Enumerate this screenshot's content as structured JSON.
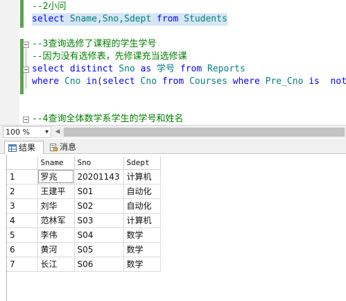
{
  "editor": {
    "lines": [
      {
        "segments": [
          {
            "t": "--2小问",
            "c": "cmt"
          }
        ]
      },
      {
        "segments": [
          {
            "t": "select",
            "c": "kw"
          },
          {
            "t": " Sname,Sno,Sdept ",
            "c": "obj"
          },
          {
            "t": "from",
            "c": "kw"
          },
          {
            "t": " Students",
            "c": "obj"
          }
        ]
      },
      {
        "segments": []
      },
      {
        "segments": [
          {
            "t": "--3查询选修了课程的学生学号",
            "c": "cmt"
          }
        ]
      },
      {
        "segments": [
          {
            "t": "--因为没有选修表，先修课充当选修课",
            "c": "cmt"
          }
        ]
      },
      {
        "segments": [
          {
            "t": "select",
            "c": "kw"
          },
          {
            "t": " ",
            "c": "plain"
          },
          {
            "t": "distinct",
            "c": "kw"
          },
          {
            "t": " Sno ",
            "c": "obj"
          },
          {
            "t": "as",
            "c": "kw"
          },
          {
            "t": " 学号 ",
            "c": "obj"
          },
          {
            "t": "from",
            "c": "kw"
          },
          {
            "t": " Reports",
            "c": "obj"
          }
        ]
      },
      {
        "segments": [
          {
            "t": "where",
            "c": "kw"
          },
          {
            "t": " Cno ",
            "c": "obj"
          },
          {
            "t": "in",
            "c": "kw"
          },
          {
            "t": "(",
            "c": "plain"
          },
          {
            "t": "select",
            "c": "kw"
          },
          {
            "t": " Cno ",
            "c": "obj"
          },
          {
            "t": "from",
            "c": "kw"
          },
          {
            "t": " Courses ",
            "c": "obj"
          },
          {
            "t": "where",
            "c": "kw"
          },
          {
            "t": " Pre_Cno ",
            "c": "obj"
          },
          {
            "t": "is",
            "c": "kw"
          },
          {
            "t": "  not",
            "c": "kw"
          }
        ]
      },
      {
        "segments": []
      },
      {
        "segments": []
      },
      {
        "segments": [
          {
            "t": "--4查询全体数学系学生的学号和姓名",
            "c": "cmt"
          }
        ]
      }
    ]
  },
  "zoom": {
    "value": "100 %"
  },
  "tabs": [
    {
      "label": "结果",
      "icon": "grid-icon"
    },
    {
      "label": "消息",
      "icon": "message-icon"
    }
  ],
  "results": {
    "columns": [
      "Sname",
      "Sno",
      "Sdept"
    ],
    "rows": [
      {
        "n": "1",
        "cells": [
          "罗兆",
          "20201143",
          "计算机"
        ]
      },
      {
        "n": "2",
        "cells": [
          "王建平",
          "S01",
          "自动化"
        ]
      },
      {
        "n": "3",
        "cells": [
          "刘华",
          "S02",
          "自动化"
        ]
      },
      {
        "n": "4",
        "cells": [
          "范林军",
          "S03",
          "计算机"
        ]
      },
      {
        "n": "5",
        "cells": [
          "李伟",
          "S04",
          "数学"
        ]
      },
      {
        "n": "6",
        "cells": [
          "黄河",
          "S05",
          "数学"
        ]
      },
      {
        "n": "7",
        "cells": [
          "长江",
          "S06",
          "数学"
        ]
      }
    ]
  }
}
